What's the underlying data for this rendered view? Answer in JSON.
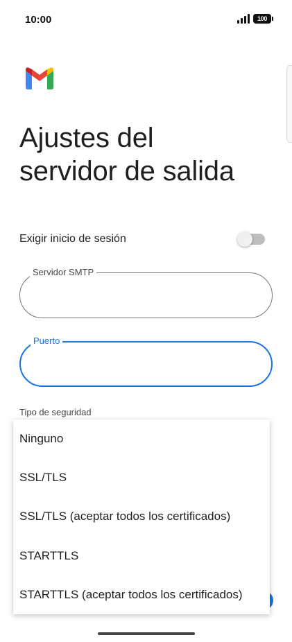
{
  "status_bar": {
    "time": "10:00",
    "battery": "100",
    "signal_icon": "cellular-signal-icon"
  },
  "app": {
    "logo": "gmail-logo-icon",
    "title_line1": "Ajustes del",
    "title_line2": "servidor de salida"
  },
  "form": {
    "require_login_label": "Exigir inicio de sesión",
    "require_login_enabled": false,
    "smtp_server": {
      "label": "Servidor SMTP",
      "value": ""
    },
    "port": {
      "label": "Puerto",
      "value": ""
    },
    "security_type_label": "Tipo de seguridad"
  },
  "security_dropdown": {
    "options": [
      "Ninguno",
      "SSL/TLS",
      "SSL/TLS (aceptar todos los certificados)",
      "STARTTLS",
      "STARTTLS (aceptar todos los certificados)"
    ]
  },
  "colors": {
    "accent": "#1a73e8",
    "gmail_red": "#ea4335",
    "gmail_blue": "#4285f4",
    "gmail_green": "#34a853",
    "gmail_yellow": "#fbbc04",
    "gmail_dark_red": "#c5221f"
  }
}
